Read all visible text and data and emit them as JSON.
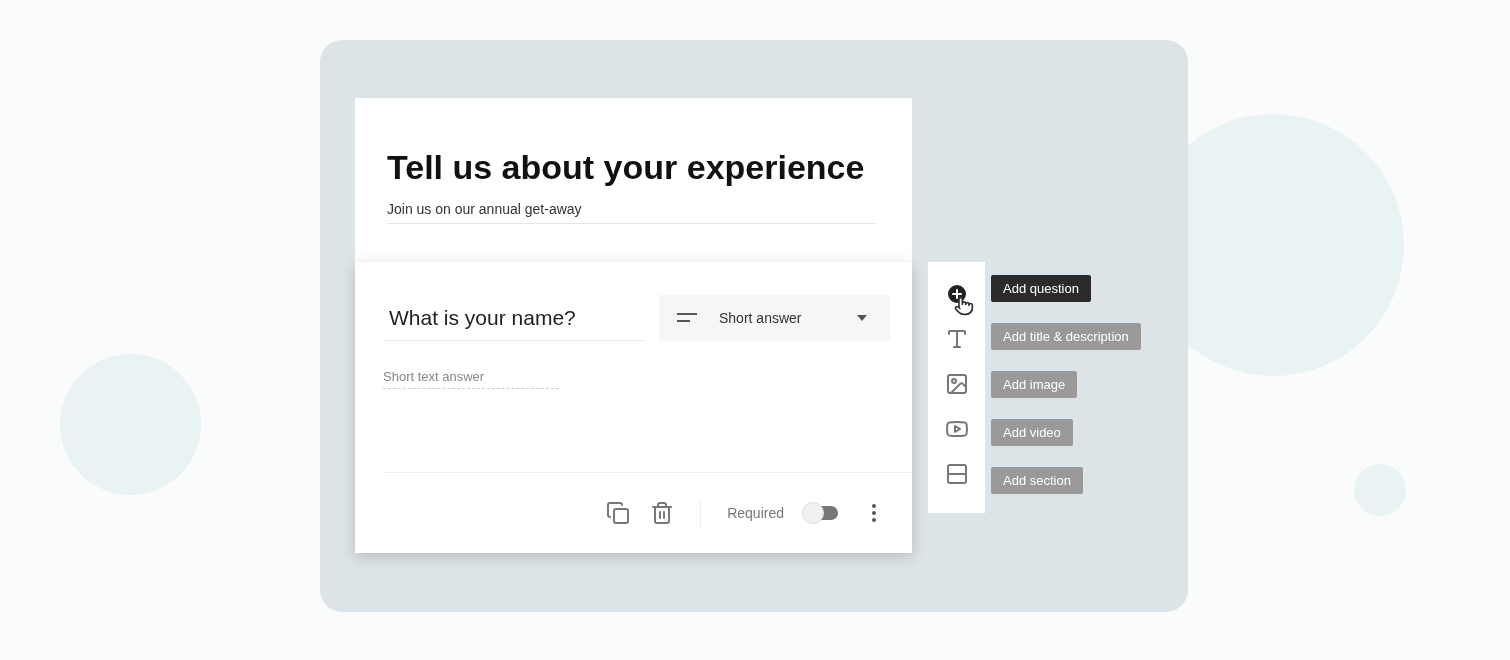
{
  "form": {
    "title": "Tell us about your experience",
    "description": "Join us on our annual get-away"
  },
  "question": {
    "title": "What is your name?",
    "type_label": "Short answer",
    "answer_placeholder": "Short text answer",
    "required_label": "Required",
    "required": false
  },
  "side_tools": [
    {
      "kind": "question",
      "tooltip": "Add question",
      "selected": true
    },
    {
      "kind": "title",
      "tooltip": "Add title & description",
      "selected": false
    },
    {
      "kind": "image",
      "tooltip": "Add image",
      "selected": false
    },
    {
      "kind": "video",
      "tooltip": "Add video",
      "selected": false
    },
    {
      "kind": "section",
      "tooltip": "Add section",
      "selected": false
    }
  ]
}
